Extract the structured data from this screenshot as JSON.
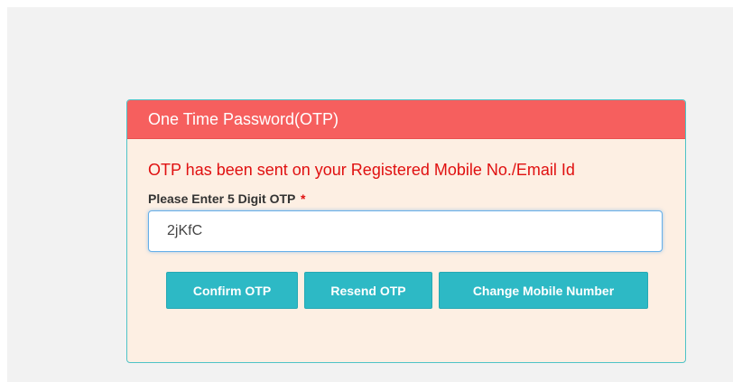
{
  "otp_panel": {
    "title": "One Time Password(OTP)",
    "message": "OTP has been sent on your Registered Mobile No./Email Id",
    "field_label": "Please Enter 5 Digit OTP",
    "required_marker": "*",
    "otp_value": "2jKfC",
    "buttons": {
      "confirm": "Confirm OTP",
      "resend": "Resend OTP",
      "change_number": "Change Mobile Number"
    }
  },
  "colors": {
    "header_background": "#f65f5e",
    "panel_background": "#fdefe3",
    "panel_border": "#4ec3c7",
    "message_text": "#e01010",
    "button_background": "#2db9c5"
  }
}
